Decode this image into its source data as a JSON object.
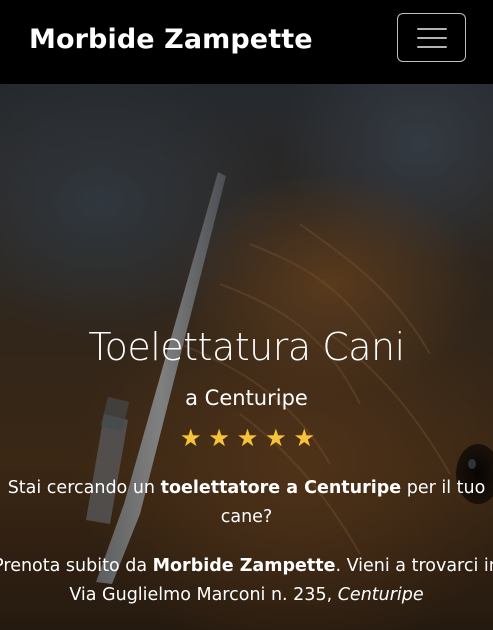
{
  "navbar": {
    "brand": "Morbide Zampette",
    "toggler_icon": "hamburger-menu-icon"
  },
  "hero": {
    "title": "Toelettatura Cani",
    "subtitle": "a Centuripe",
    "rating_stars": 5,
    "star_icon": "star-icon",
    "star_color": "#f7c23c",
    "intro": {
      "prefix": "Stai cercando un ",
      "bold": "toelettatore a Centuripe",
      "suffix": " per il tuo",
      "line2": "cane?"
    },
    "cta": {
      "prefix": "Prenota subito da ",
      "bold": "Morbide Zampette",
      "suffix": ". Vieni a trovarci in",
      "address": "Via Guglielmo Marconi n. 235, ",
      "city": "Centuripe"
    }
  }
}
